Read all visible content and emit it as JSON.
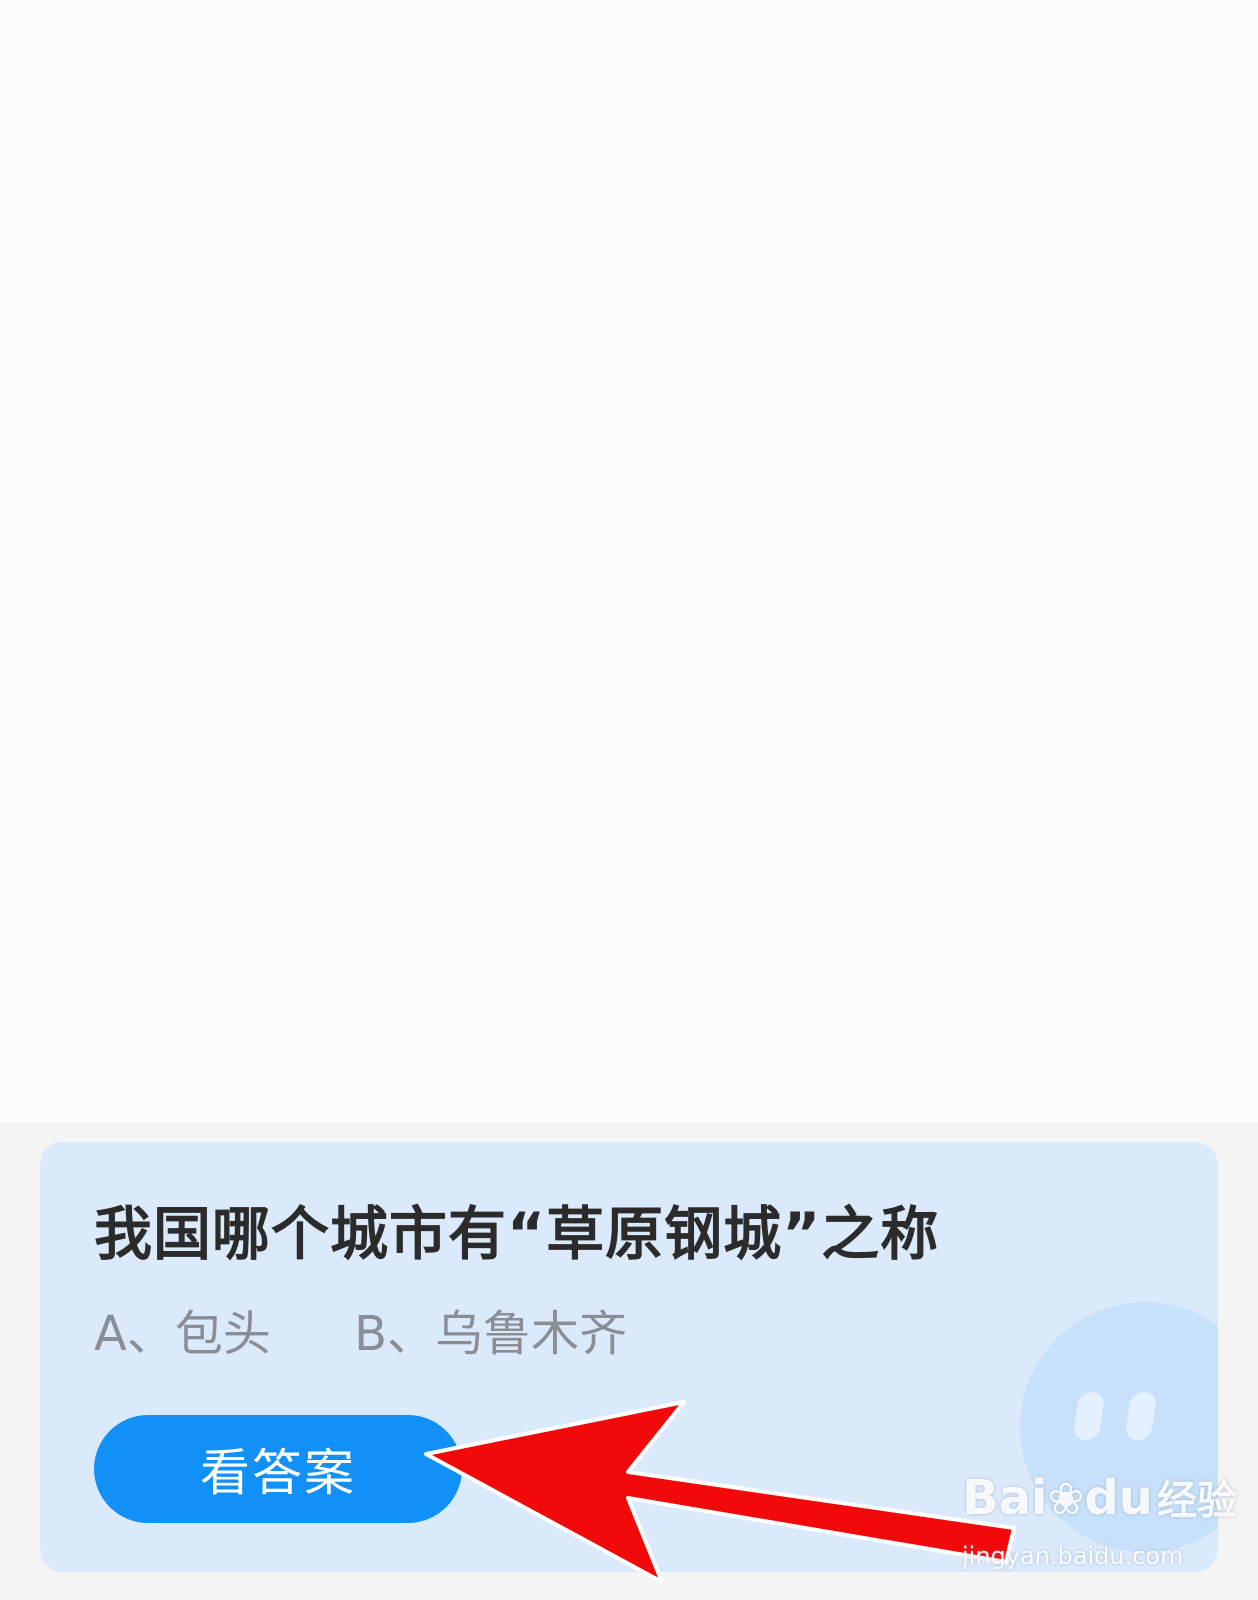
{
  "quiz": {
    "question": "我国哪个城市有“草原钢城”之称",
    "options": [
      {
        "label": "A、包头"
      },
      {
        "label": "B、乌鲁木齐"
      }
    ],
    "answer_button_label": "看答案"
  },
  "watermark": {
    "brand_text": "Bai",
    "brand_text2": "du",
    "brand_suffix": "经验",
    "url": "jingyan.baidu.com"
  },
  "colors": {
    "page_background": "#fcfcfc",
    "card_background": "#dbeafb",
    "button_background": "#1190f8",
    "arrow": "#f20a0a"
  },
  "icons": {
    "annotation_arrow": "red-arrow-icon",
    "mascot": "mascot-icon",
    "watermark_paw": "baidu-paw-icon"
  }
}
